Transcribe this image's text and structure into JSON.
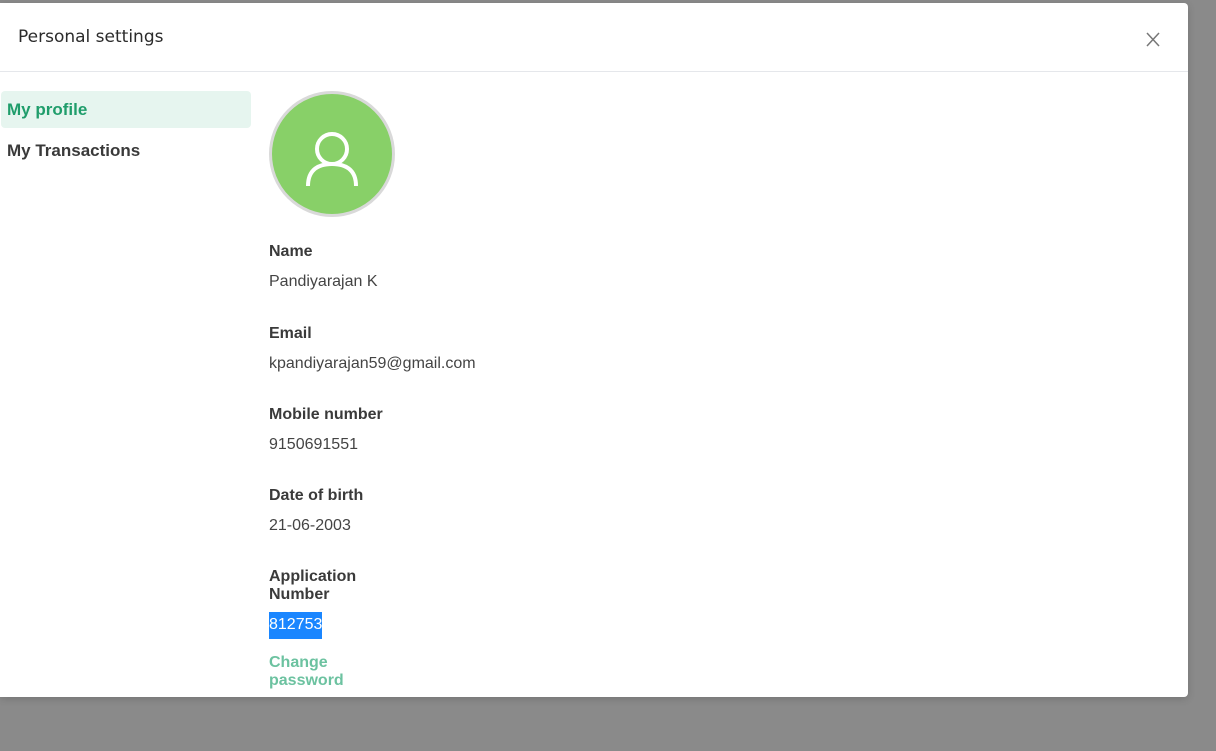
{
  "modal": {
    "title": "Personal settings",
    "close_label": "X"
  },
  "sidebar": {
    "items": [
      {
        "label": "My profile",
        "active": true
      },
      {
        "label": "My Transactions",
        "active": false
      }
    ]
  },
  "profile": {
    "avatar_icon": "user-icon",
    "fields": [
      {
        "label": "Name",
        "value": "Pandiyarajan K"
      },
      {
        "label": "Email",
        "value": "kpandiyarajan59@gmail.com"
      },
      {
        "label": "Mobile number",
        "value": "9150691551"
      },
      {
        "label": "Date of birth",
        "value": "21-06-2003"
      },
      {
        "label": "Application Number",
        "value": "812753"
      }
    ],
    "change_password_label": "Change password"
  },
  "colors": {
    "accent": "#1f9d6b",
    "accent_light": "#e6f5ef",
    "avatar_bg": "#88d068",
    "selection": "#1a86ff",
    "link": "#6cc2a0",
    "backdrop": "#8a8a8a"
  }
}
